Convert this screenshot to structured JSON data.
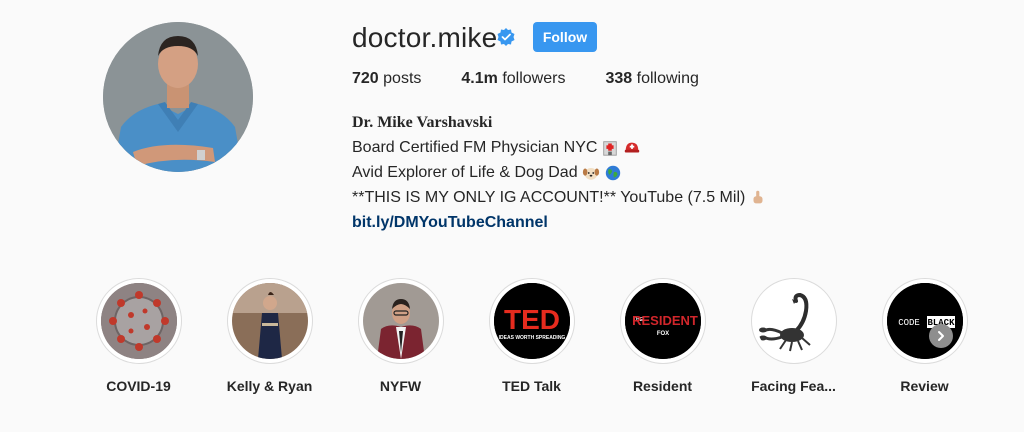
{
  "profile": {
    "username": "doctor.mike",
    "follow_label": "Follow",
    "stats": {
      "posts_count": "720",
      "posts_label": "posts",
      "followers_count": "4.1m",
      "followers_label": "followers",
      "following_count": "338",
      "following_label": "following"
    },
    "bio": {
      "full_name": "Dr. Mike Varshavski",
      "line1": "Board Certified FM Physician NYC",
      "line2": "Avid Explorer of Life & Dog Dad",
      "line3": "**THIS IS MY ONLY IG ACCOUNT!** YouTube (7.5 Mil)",
      "link": "bit.ly/DMYouTubeChannel"
    }
  },
  "highlights": [
    {
      "label": "COVID-19",
      "icon": "virus"
    },
    {
      "label": "Kelly & Ryan",
      "icon": "photo"
    },
    {
      "label": "NYFW",
      "icon": "photo"
    },
    {
      "label": "TED Talk",
      "icon": "ted-logo",
      "logo_text": "TED",
      "logo_sub": "IDEAS WORTH SPREADING"
    },
    {
      "label": "Resident",
      "icon": "resident-logo",
      "logo_pre": "THE",
      "logo_text": "RESIDENT",
      "logo_sub": "FOX"
    },
    {
      "label": "Facing Fea...",
      "icon": "scorpion"
    },
    {
      "label": "Review",
      "icon": "code-black-logo",
      "logo_text": "CODE",
      "logo_sub": "BLACK"
    }
  ],
  "colors": {
    "follow_button": "#3897f0",
    "verified_badge": "#3897f0",
    "link": "#003569",
    "background": "#fafafa"
  }
}
